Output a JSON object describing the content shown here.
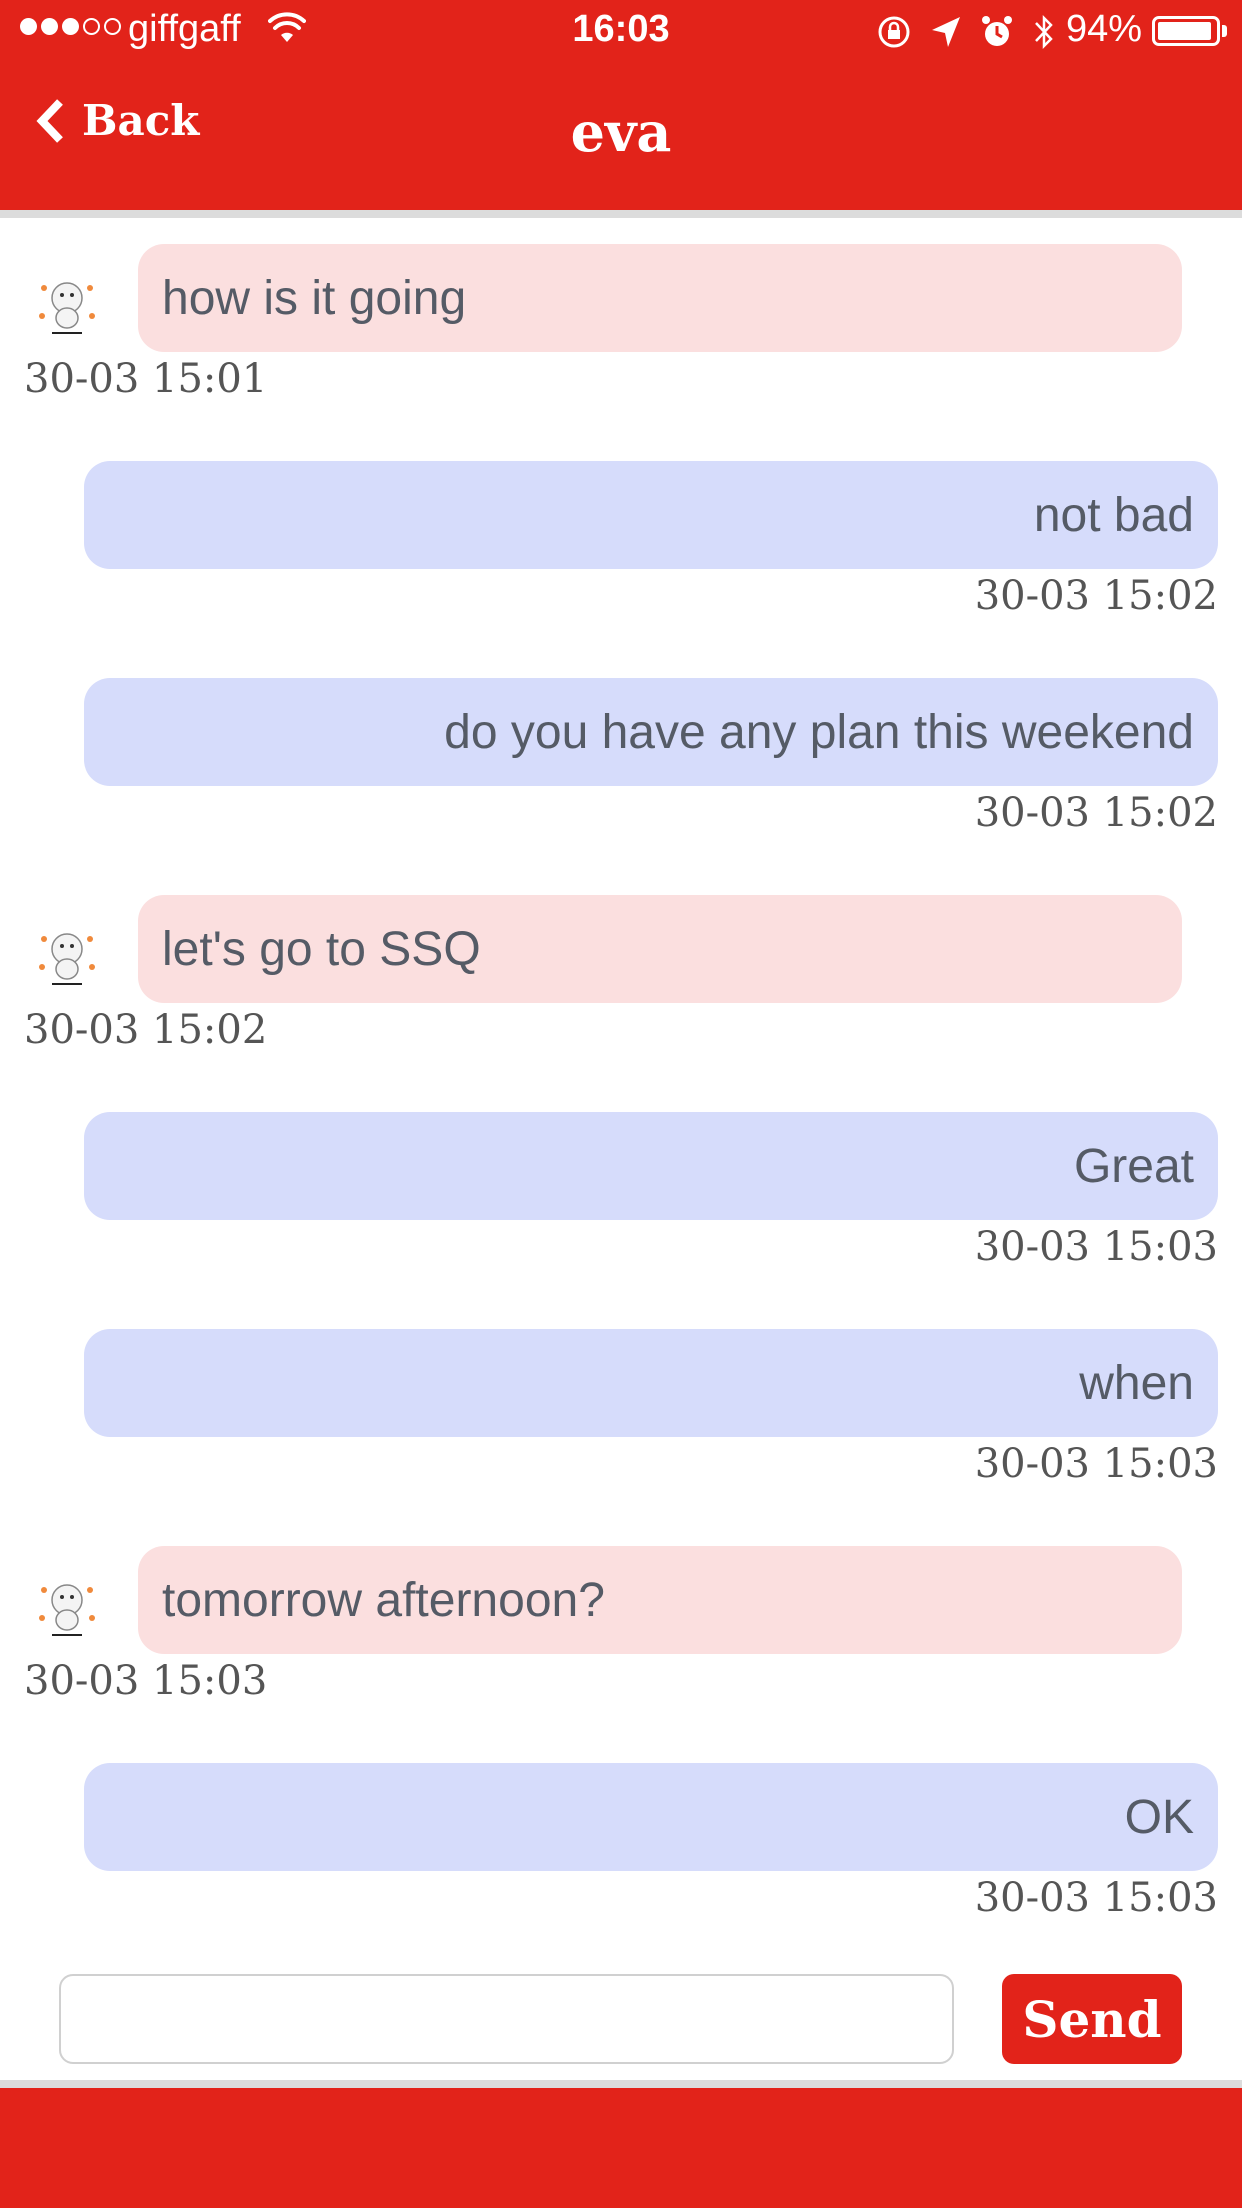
{
  "status_bar": {
    "carrier": "giffgaff",
    "time": "16:03",
    "battery": "94%",
    "battery_level": 0.94,
    "signal_bars_filled": 3,
    "signal_bars_total": 5
  },
  "nav": {
    "back_label": "Back",
    "title": "eva"
  },
  "colors": {
    "accent": "#e2231a",
    "incoming_bubble": "#fbdfdf",
    "outgoing_bubble": "#d6dcfb"
  },
  "messages": [
    {
      "direction": "in",
      "text": "how is it going",
      "time": "30-03 15:01"
    },
    {
      "direction": "out",
      "text": "not bad",
      "time": "30-03 15:02"
    },
    {
      "direction": "out",
      "text": "do you have any plan this weekend",
      "time": "30-03 15:02"
    },
    {
      "direction": "in",
      "text": "let's go to SSQ",
      "time": "30-03 15:02"
    },
    {
      "direction": "out",
      "text": "Great",
      "time": "30-03 15:03"
    },
    {
      "direction": "out",
      "text": "when",
      "time": "30-03 15:03"
    },
    {
      "direction": "in",
      "text": "tomorrow afternoon?",
      "time": "30-03 15:03"
    },
    {
      "direction": "out",
      "text": "OK",
      "time": "30-03 15:03"
    }
  ],
  "composer": {
    "value": "",
    "placeholder": "",
    "send_label": "Send"
  }
}
